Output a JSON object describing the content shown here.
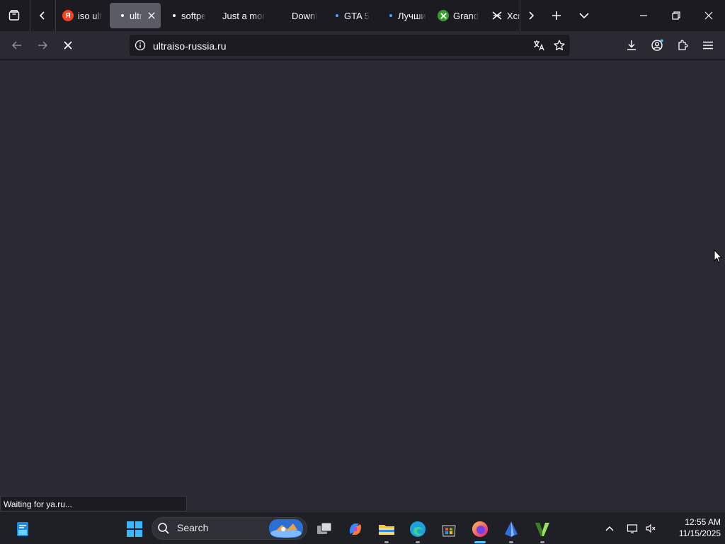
{
  "tabs": [
    {
      "title": "iso ult",
      "favicon": "yandex-icon",
      "active": false
    },
    {
      "title": "ultr",
      "favicon": "loading-dot",
      "active": true
    },
    {
      "title": "softpe",
      "favicon": "loading-dot",
      "active": false
    },
    {
      "title": "Just a mor",
      "favicon": "none",
      "active": false
    },
    {
      "title": "Downl",
      "favicon": "none",
      "active": false
    },
    {
      "title": "GTA 5",
      "favicon": "loading-dot",
      "active": false
    },
    {
      "title": "Лучши",
      "favicon": "loading-dot",
      "active": false
    },
    {
      "title": "Grand",
      "favicon": "xbox-icon",
      "active": false
    },
    {
      "title": "Xcr",
      "favicon": "xcraft-icon",
      "active": false
    }
  ],
  "urlbar": {
    "url": "ultraiso-russia.ru"
  },
  "statusbar": {
    "text": "Waiting for ya.ru..."
  },
  "taskbar": {
    "search_label": "Search",
    "time": "12:55 AM",
    "date": "11/15/2025"
  },
  "colors": {
    "accent": "#4cc2ff",
    "yandex": "#fc3f1d",
    "xbox": "#3a9a2f"
  }
}
